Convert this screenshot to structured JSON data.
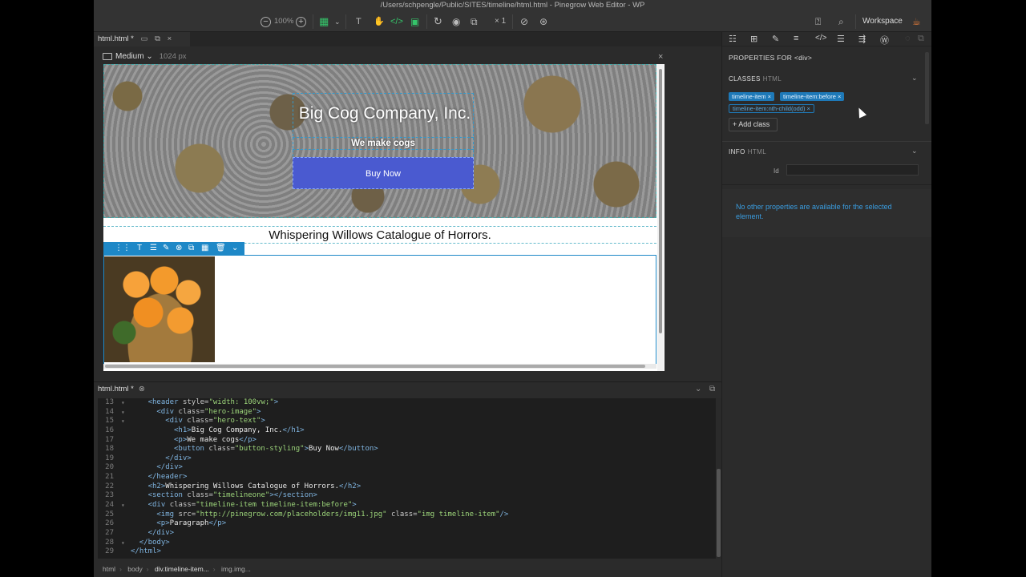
{
  "window": {
    "title": "/Users/schpengle/Public/SITES/timeline/html.html - Pinegrow Web Editor - WP"
  },
  "toolbar": {
    "zoom": "100%",
    "multiplier": "× 1",
    "workspace_label": "Workspace",
    "text_tool": "T",
    "code_view": "</>"
  },
  "editor_tab": {
    "label": "html.html *"
  },
  "page_view": {
    "device": "Medium",
    "width": "1024 px"
  },
  "page": {
    "hero_title": "Big Cog Company, Inc.",
    "hero_subtitle": "We make cogs",
    "hero_button": "Buy Now",
    "section_heading": "Whispering Willows Catalogue of Horrors."
  },
  "code_tab": {
    "label": "html.html *"
  },
  "code_lines": [
    {
      "n": "13",
      "fold": true,
      "html": "<span class='tag'>&lt;header</span> <span class='attr'>style=</span><span class='str'>\"width: 100vw;\"</span><span class='tag'>&gt;</span>",
      "indent": 4
    },
    {
      "n": "14",
      "fold": true,
      "html": "<span class='tag'>&lt;div</span> <span class='attr'>class=</span><span class='str'>\"hero-image\"</span><span class='tag'>&gt;</span>",
      "indent": 6
    },
    {
      "n": "15",
      "fold": true,
      "html": "<span class='tag'>&lt;div</span> <span class='attr'>class=</span><span class='str'>\"hero-text\"</span><span class='tag'>&gt;</span>",
      "indent": 8
    },
    {
      "n": "16",
      "fold": false,
      "html": "<span class='tag'>&lt;h1&gt;</span>Big Cog Company, Inc.<span class='tag'>&lt;/h1&gt;</span>",
      "indent": 10
    },
    {
      "n": "17",
      "fold": false,
      "html": "<span class='tag'>&lt;p&gt;</span>We make cogs<span class='tag'>&lt;/p&gt;</span>",
      "indent": 10
    },
    {
      "n": "18",
      "fold": false,
      "html": "<span class='tag'>&lt;button</span> <span class='attr'>class=</span><span class='str'>\"button-styling\"</span><span class='tag'>&gt;</span>Buy Now<span class='tag'>&lt;/button&gt;</span>",
      "indent": 10
    },
    {
      "n": "19",
      "fold": false,
      "html": "<span class='tag'>&lt;/div&gt;</span>",
      "indent": 8
    },
    {
      "n": "20",
      "fold": false,
      "html": "<span class='tag'>&lt;/div&gt;</span>",
      "indent": 6
    },
    {
      "n": "21",
      "fold": false,
      "html": "<span class='tag'>&lt;/header&gt;</span>",
      "indent": 4
    },
    {
      "n": "22",
      "fold": false,
      "html": "<span class='tag'>&lt;h2&gt;</span>Whispering Willows Catalogue of Horrors.<span class='tag'>&lt;/h2&gt;</span>",
      "indent": 4
    },
    {
      "n": "23",
      "fold": false,
      "html": "<span class='tag'>&lt;section</span> <span class='attr'>class=</span><span class='str'>\"timelineone\"</span><span class='tag'>&gt;&lt;/section&gt;</span>",
      "indent": 4
    },
    {
      "n": "24",
      "fold": true,
      "html": "<span class='tag'>&lt;div</span> <span class='attr'>class=</span><span class='str'>\"timeline-item timeline-item:before\"</span><span class='tag'>&gt;</span>",
      "indent": 4
    },
    {
      "n": "25",
      "fold": false,
      "html": "<span class='tag'>&lt;img</span> <span class='attr'>src=</span><span class='str'>\"http://pinegrow.com/placeholders/img11.jpg\"</span> <span class='attr'>class=</span><span class='str'>\"img timeline-item\"</span><span class='tag'>/&gt;</span>",
      "indent": 6
    },
    {
      "n": "26",
      "fold": false,
      "html": "<span class='tag'>&lt;p&gt;</span>Paragraph<span class='tag'>&lt;/p&gt;</span>",
      "indent": 6
    },
    {
      "n": "27",
      "fold": false,
      "html": "<span class='tag'>&lt;/div&gt;</span>",
      "indent": 4
    },
    {
      "n": "28",
      "fold": true,
      "html": "<span class='tag'>&lt;/body&gt;</span>",
      "indent": 2
    },
    {
      "n": "29",
      "fold": false,
      "html": "<span class='tag'>&lt;/html&gt;</span>",
      "indent": 0
    }
  ],
  "breadcrumb": [
    "html",
    "body",
    "div.timeline-item...",
    "img.img..."
  ],
  "properties": {
    "title": "PROPERTIES FOR",
    "element": "<div>",
    "classes_label": "CLASSES",
    "classes_sub": "HTML",
    "classes": [
      {
        "name": "timeline-item",
        "style": "solid"
      },
      {
        "name": "timeline-item:before",
        "style": "solid"
      },
      {
        "name": "timeline-item:nth-child(odd)",
        "style": "outline"
      }
    ],
    "add_class": "Add class",
    "info_label": "INFO",
    "info_sub": "HTML",
    "id_label": "Id",
    "no_props_message": "No other properties are available for the selected element."
  },
  "colors": {
    "accent": "#1e79b8",
    "button": "#4a5ad0",
    "green": "#35c46a"
  }
}
